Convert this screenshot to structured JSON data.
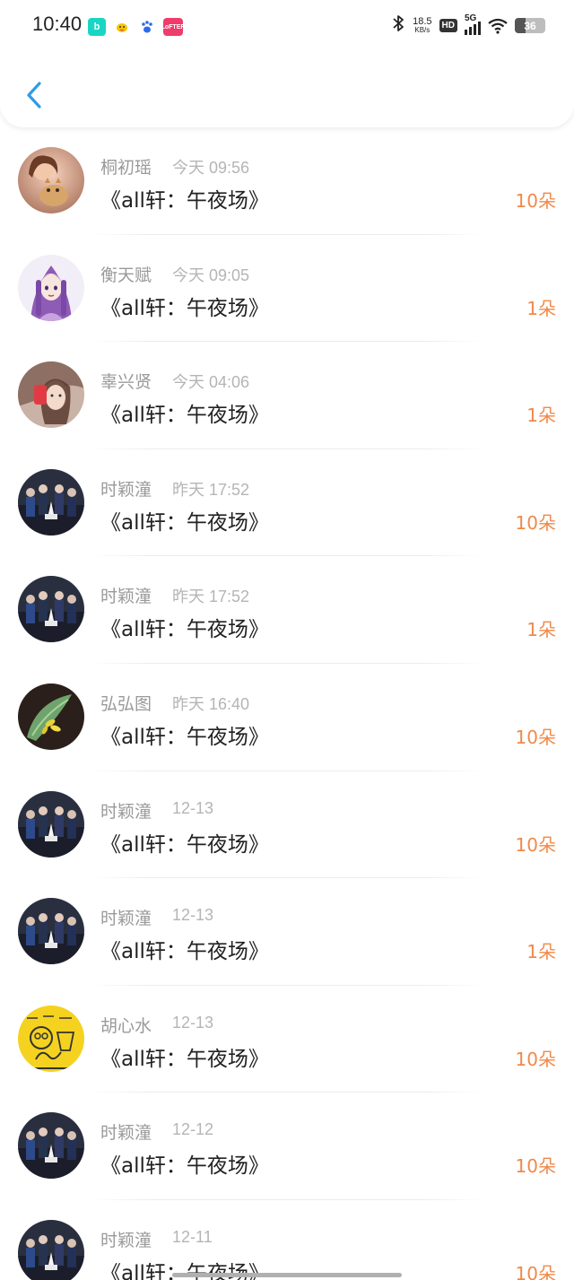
{
  "status_bar": {
    "time": "10:40",
    "notif_icons": [
      "b-app-icon",
      "bird-app-icon",
      "paw-app-icon",
      "lofter-app-icon"
    ],
    "lofter_label": "LoFTER",
    "b_label": "b",
    "net_speed_value": "18.5",
    "net_speed_unit": "KB/s",
    "hd_label": "HD",
    "network_label": "5G",
    "battery_level": "36",
    "battery_fraction": 0.36
  },
  "nav": {
    "back_icon": "chevron-left-icon",
    "accent_color": "#2f9be4"
  },
  "colors": {
    "name": "#9a9a9a",
    "time": "#b5b5b5",
    "title": "#222222",
    "amount": "#f0894a"
  },
  "items": [
    {
      "name": "桐初瑶",
      "time": "今天 09:56",
      "title": "《all轩：午夜场》",
      "amount": "10朵",
      "avatar": "photo-girl-with-cat"
    },
    {
      "name": "衡天赋",
      "time": "今天 09:05",
      "title": "《all轩：午夜场》",
      "amount": "1朵",
      "avatar": "illustration-purple-hair"
    },
    {
      "name": "辜兴贤",
      "time": "今天 04:06",
      "title": "《all轩：午夜场》",
      "amount": "1朵",
      "avatar": "photo-selfie-red"
    },
    {
      "name": "时颖潼",
      "time": "昨天 17:52",
      "title": "《all轩：午夜场》",
      "amount": "10朵",
      "avatar": "photo-group-dark"
    },
    {
      "name": "时颖潼",
      "time": "昨天 17:52",
      "title": "《all轩：午夜场》",
      "amount": "1朵",
      "avatar": "photo-group-dark"
    },
    {
      "name": "弘弘图",
      "time": "昨天 16:40",
      "title": "《all轩：午夜场》",
      "amount": "10朵",
      "avatar": "photo-green-plant"
    },
    {
      "name": "时颖潼",
      "time": "12-13",
      "title": "《all轩：午夜场》",
      "amount": "10朵",
      "avatar": "photo-group-dark"
    },
    {
      "name": "时颖潼",
      "time": "12-13",
      "title": "《all轩：午夜场》",
      "amount": "1朵",
      "avatar": "photo-group-dark"
    },
    {
      "name": "胡心水",
      "time": "12-13",
      "title": "《all轩：午夜场》",
      "amount": "10朵",
      "avatar": "cartoon-yellow"
    },
    {
      "name": "时颖潼",
      "time": "12-12",
      "title": "《all轩：午夜场》",
      "amount": "10朵",
      "avatar": "photo-group-dark"
    },
    {
      "name": "时颖潼",
      "time": "12-11",
      "title": "《all轩：午夜场》",
      "amount": "10朵",
      "avatar": "photo-group-dark"
    }
  ]
}
